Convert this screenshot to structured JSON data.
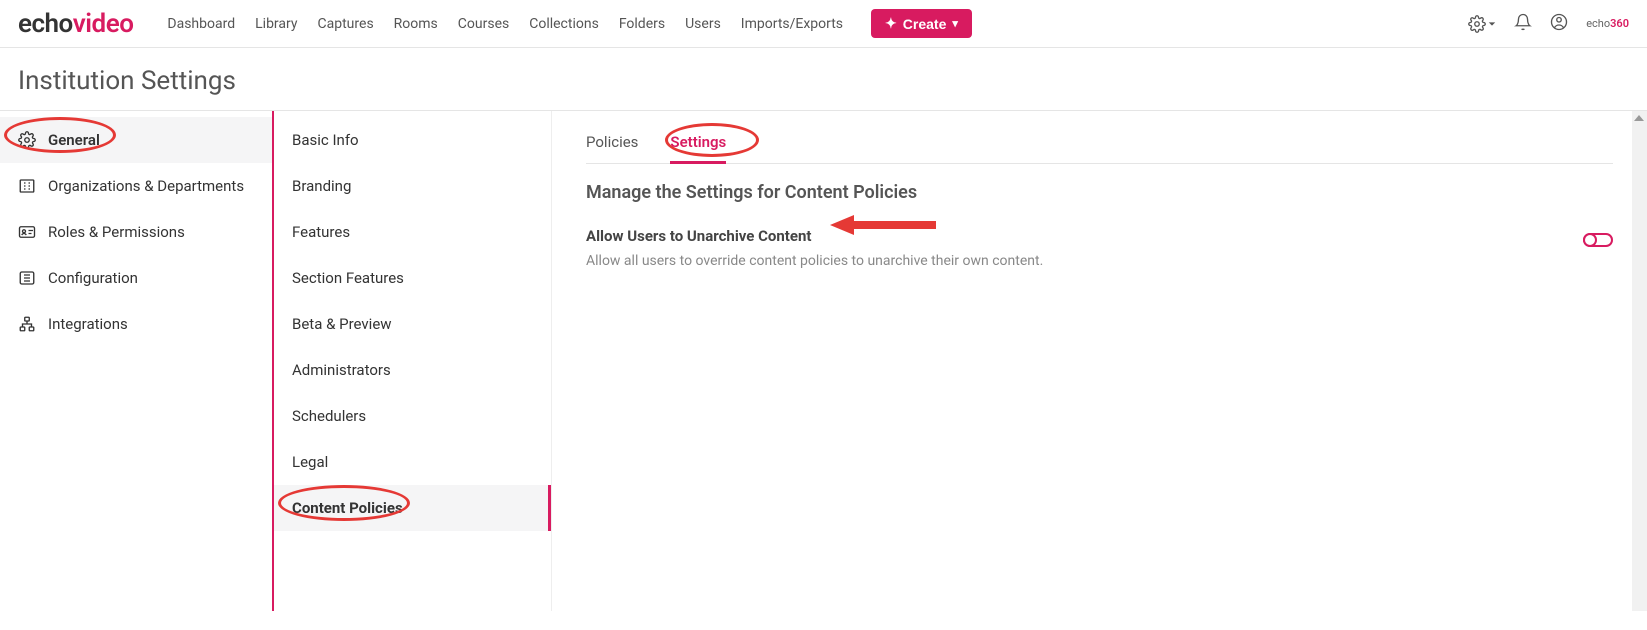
{
  "brand": {
    "echo": "echo",
    "video": "video"
  },
  "nav": {
    "items": [
      "Dashboard",
      "Library",
      "Captures",
      "Rooms",
      "Courses",
      "Collections",
      "Folders",
      "Users",
      "Imports/Exports"
    ],
    "create_label": "Create"
  },
  "small_logo": {
    "echo": "echo",
    "e360": "360"
  },
  "page": {
    "title": "Institution Settings"
  },
  "left_nav": {
    "items": [
      {
        "label": "General",
        "active": true
      },
      {
        "label": "Organizations & Departments",
        "active": false
      },
      {
        "label": "Roles & Permissions",
        "active": false
      },
      {
        "label": "Configuration",
        "active": false
      },
      {
        "label": "Integrations",
        "active": false
      }
    ]
  },
  "sub_nav": {
    "items": [
      {
        "label": "Basic Info",
        "active": false
      },
      {
        "label": "Branding",
        "active": false
      },
      {
        "label": "Features",
        "active": false
      },
      {
        "label": "Section Features",
        "active": false
      },
      {
        "label": "Beta & Preview",
        "active": false
      },
      {
        "label": "Administrators",
        "active": false
      },
      {
        "label": "Schedulers",
        "active": false
      },
      {
        "label": "Legal",
        "active": false
      },
      {
        "label": "Content Policies",
        "active": true
      }
    ]
  },
  "main": {
    "tabs": [
      {
        "label": "Policies",
        "active": false
      },
      {
        "label": "Settings",
        "active": true
      }
    ],
    "section_heading": "Manage the Settings for Content Policies",
    "setting": {
      "title": "Allow Users to Unarchive Content",
      "description": "Allow all users to override content policies to unarchive their own content.",
      "enabled": false
    }
  }
}
